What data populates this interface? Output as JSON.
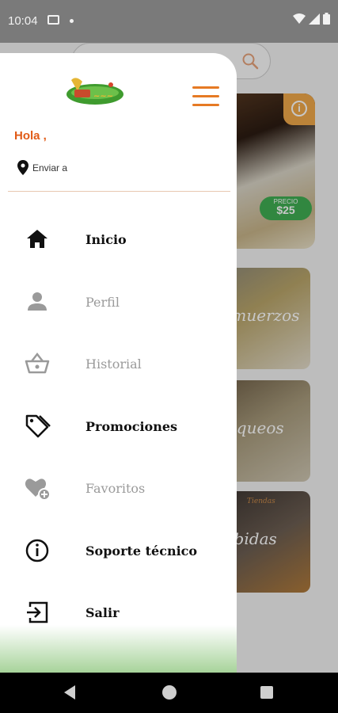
{
  "status_bar": {
    "time": "10:04"
  },
  "background": {
    "promo_price_label": "PRECIO",
    "promo_price": "$25",
    "categories": [
      "lmuerzos",
      "liqueos",
      "rbidas"
    ],
    "cat3_header": "Tiendas"
  },
  "drawer": {
    "greeting": "Hola ,",
    "send_to": "Enviar a",
    "menu": [
      {
        "label": "Inicio",
        "icon": "home-icon",
        "state": "active"
      },
      {
        "label": "Perfil",
        "icon": "person-icon",
        "state": "disabled"
      },
      {
        "label": "Historial",
        "icon": "basket-icon",
        "state": "disabled"
      },
      {
        "label": "Promociones",
        "icon": "tag-icon",
        "state": "active"
      },
      {
        "label": "Favoritos",
        "icon": "heart-add-icon",
        "state": "disabled"
      },
      {
        "label": "Soporte técnico",
        "icon": "info-icon",
        "state": "active"
      },
      {
        "label": "Salir",
        "icon": "exit-icon",
        "state": "active"
      }
    ]
  },
  "colors": {
    "accent": "#e15b17",
    "hamburger": "#e67a24",
    "active_text": "#111111",
    "disabled_text": "#9a9a9a"
  }
}
